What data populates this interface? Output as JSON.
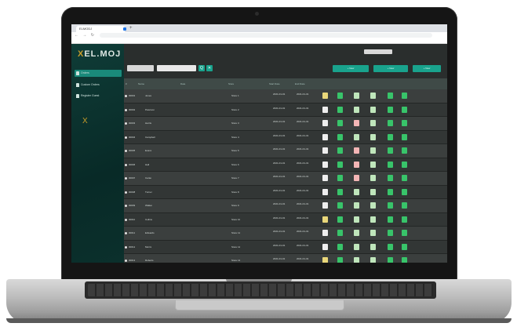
{
  "browser": {
    "tab_title": "ELMODJ",
    "new_tab": "+",
    "nav_buttons": "← → ↻",
    "url": "",
    "bookmarks": [
      "",
      "",
      "",
      "",
      "",
      "",
      "",
      "",
      "",
      ""
    ]
  },
  "sidebar": {
    "logo_x": "X",
    "logo_text": "EL.MOJ",
    "items": [
      {
        "label": "Orders"
      },
      {
        "label": "Custom Orders"
      },
      {
        "label": "Register Guest"
      }
    ],
    "brand_symbol": "X",
    "brand_text": ""
  },
  "toolbar": {
    "user_box": "",
    "user_text": "",
    "search_placeholder": "",
    "filter_placeholder": "",
    "search_btn": "Q",
    "clear_btn": "✕",
    "actions": [
      "+ New",
      "+ New",
      "+ New"
    ]
  },
  "colors": {
    "accent": "#19a38d",
    "yellow": "#e9d77a",
    "green": "#38c46a",
    "light_green": "#bfe6bb",
    "pink": "#f3b5b5",
    "white": "#eeeeee"
  },
  "table": {
    "headers": [
      "#",
      "Name",
      "Date",
      "Store",
      "Start Date",
      "End Date",
      "",
      "",
      "",
      "",
      "",
      "",
      ""
    ],
    "rows": [
      {
        "id": "00001",
        "name": "Jones",
        "store": "Store 1",
        "start": "2021-01-01",
        "end": "2021-01-31",
        "s": [
          "y",
          "g",
          "l",
          "l",
          "g",
          "g"
        ]
      },
      {
        "id": "00002",
        "name": "Peterson",
        "store": "Store 2",
        "start": "2021-01-01",
        "end": "2021-01-31",
        "s": [
          "w",
          "g",
          "l",
          "l",
          "g",
          "g"
        ]
      },
      {
        "id": "00003",
        "name": "Harris",
        "store": "Store 3",
        "start": "2021-01-01",
        "end": "2021-01-31",
        "s": [
          "w",
          "g",
          "p",
          "l",
          "g",
          "g"
        ]
      },
      {
        "id": "00004",
        "name": "Campbell",
        "store": "Store 4",
        "start": "2021-01-01",
        "end": "2021-01-31",
        "s": [
          "w",
          "g",
          "l",
          "l",
          "g",
          "g"
        ]
      },
      {
        "id": "00005",
        "name": "Evans",
        "store": "Store 5",
        "start": "2021-01-01",
        "end": "2021-01-31",
        "s": [
          "w",
          "g",
          "p",
          "l",
          "g",
          "g"
        ]
      },
      {
        "id": "00006",
        "name": "Hall",
        "store": "Store 6",
        "start": "2021-01-01",
        "end": "2021-01-31",
        "s": [
          "w",
          "g",
          "p",
          "l",
          "g",
          "g"
        ]
      },
      {
        "id": "00007",
        "name": "Carter",
        "store": "Store 7",
        "start": "2021-01-01",
        "end": "2021-01-31",
        "s": [
          "w",
          "g",
          "p",
          "l",
          "g",
          "g"
        ]
      },
      {
        "id": "00008",
        "name": "Turner",
        "store": "Store 8",
        "start": "2021-01-01",
        "end": "2021-01-31",
        "s": [
          "w",
          "g",
          "l",
          "l",
          "g",
          "g"
        ]
      },
      {
        "id": "00009",
        "name": "Walker",
        "store": "Store 9",
        "start": "2021-01-01",
        "end": "2021-01-31",
        "s": [
          "w",
          "g",
          "l",
          "l",
          "g",
          "g"
        ]
      },
      {
        "id": "00010",
        "name": "Collins",
        "store": "Store 10",
        "start": "2021-01-01",
        "end": "2021-01-31",
        "s": [
          "y",
          "g",
          "l",
          "l",
          "g",
          "g"
        ]
      },
      {
        "id": "00011",
        "name": "Edwards",
        "store": "Store 11",
        "start": "2021-01-01",
        "end": "2021-01-31",
        "s": [
          "w",
          "g",
          "l",
          "l",
          "g",
          "g"
        ]
      },
      {
        "id": "00012",
        "name": "Morris",
        "store": "Store 12",
        "start": "2021-01-01",
        "end": "2021-01-31",
        "s": [
          "w",
          "g",
          "l",
          "l",
          "g",
          "g"
        ]
      },
      {
        "id": "00013",
        "name": "Roberts",
        "store": "Store 13",
        "start": "2021-01-01",
        "end": "2021-01-31",
        "s": [
          "y",
          "g",
          "l",
          "l",
          "g",
          "g"
        ]
      }
    ]
  }
}
